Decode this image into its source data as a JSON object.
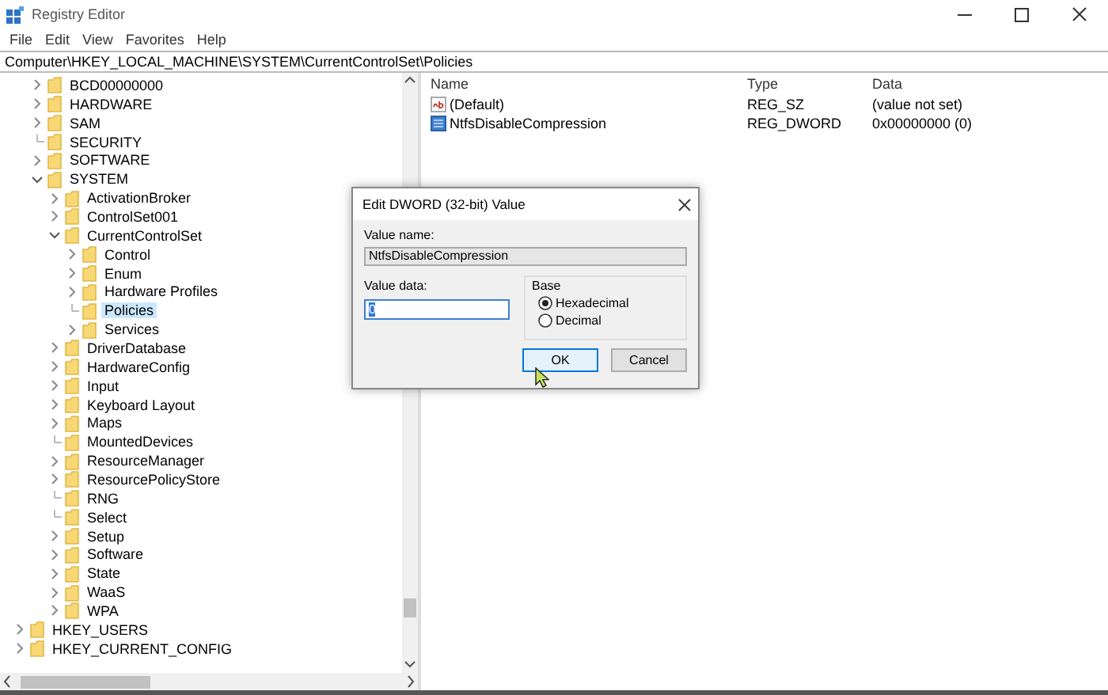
{
  "window": {
    "title": "Registry Editor"
  },
  "menu": [
    "File",
    "Edit",
    "View",
    "Favorites",
    "Help"
  ],
  "address": "Computer\\HKEY_LOCAL_MACHINE\\SYSTEM\\CurrentControlSet\\Policies",
  "tree": {
    "items": [
      {
        "label": "BCD00000000",
        "expandable": true,
        "expanded": false,
        "selected": false
      },
      {
        "label": "HARDWARE",
        "expandable": true,
        "expanded": false,
        "selected": false
      },
      {
        "label": "SAM",
        "expandable": true,
        "expanded": false,
        "selected": false
      },
      {
        "label": "SECURITY",
        "expandable": false,
        "selected": false
      },
      {
        "label": "SOFTWARE",
        "expandable": true,
        "expanded": false,
        "selected": false
      },
      {
        "label": "SYSTEM",
        "expandable": true,
        "expanded": true,
        "selected": false,
        "children": [
          {
            "label": "ActivationBroker",
            "expandable": true,
            "expanded": false,
            "selected": false
          },
          {
            "label": "ControlSet001",
            "expandable": true,
            "expanded": false,
            "selected": false
          },
          {
            "label": "CurrentControlSet",
            "expandable": true,
            "expanded": true,
            "selected": false,
            "children": [
              {
                "label": "Control",
                "expandable": true,
                "expanded": false,
                "selected": false
              },
              {
                "label": "Enum",
                "expandable": true,
                "expanded": false,
                "selected": false
              },
              {
                "label": "Hardware Profiles",
                "expandable": true,
                "expanded": false,
                "selected": false
              },
              {
                "label": "Policies",
                "expandable": false,
                "selected": true
              },
              {
                "label": "Services",
                "expandable": true,
                "expanded": false,
                "selected": false
              }
            ]
          },
          {
            "label": "DriverDatabase",
            "expandable": true,
            "expanded": false,
            "selected": false
          },
          {
            "label": "HardwareConfig",
            "expandable": true,
            "expanded": false,
            "selected": false
          },
          {
            "label": "Input",
            "expandable": true,
            "expanded": false,
            "selected": false
          },
          {
            "label": "Keyboard Layout",
            "expandable": true,
            "expanded": false,
            "selected": false
          },
          {
            "label": "Maps",
            "expandable": true,
            "expanded": false,
            "selected": false
          },
          {
            "label": "MountedDevices",
            "expandable": false,
            "selected": false
          },
          {
            "label": "ResourceManager",
            "expandable": true,
            "expanded": false,
            "selected": false
          },
          {
            "label": "ResourcePolicyStore",
            "expandable": true,
            "expanded": false,
            "selected": false
          },
          {
            "label": "RNG",
            "expandable": false,
            "selected": false
          },
          {
            "label": "Select",
            "expandable": false,
            "selected": false
          },
          {
            "label": "Setup",
            "expandable": true,
            "expanded": false,
            "selected": false
          },
          {
            "label": "Software",
            "expandable": true,
            "expanded": false,
            "selected": false
          },
          {
            "label": "State",
            "expandable": true,
            "expanded": false,
            "selected": false
          },
          {
            "label": "WaaS",
            "expandable": true,
            "expanded": false,
            "selected": false
          },
          {
            "label": "WPA",
            "expandable": true,
            "expanded": false,
            "selected": false
          }
        ]
      }
    ],
    "roots": [
      {
        "label": "HKEY_USERS",
        "expandable": true,
        "expanded": false,
        "selected": false
      },
      {
        "label": "HKEY_CURRENT_CONFIG",
        "expandable": true,
        "expanded": false,
        "selected": false
      }
    ]
  },
  "values": {
    "columns": [
      "Name",
      "Type",
      "Data"
    ],
    "rows": [
      {
        "kind": "string",
        "name": "(Default)",
        "type": "REG_SZ",
        "data": "(value not set)"
      },
      {
        "kind": "dword",
        "name": "NtfsDisableCompression",
        "type": "REG_DWORD",
        "data": "0x00000000 (0)"
      }
    ]
  },
  "dialog": {
    "title": "Edit DWORD (32-bit) Value",
    "value_name_label": "Value name:",
    "value_name": "NtfsDisableCompression",
    "value_data_label": "Value data:",
    "value_data": "0",
    "value_highlighted": true,
    "base_label": "Base",
    "base_options": [
      {
        "label": "Hexadecimal",
        "selected": true
      },
      {
        "label": "Decimal",
        "selected": false
      }
    ],
    "buttons": [
      {
        "label": "OK",
        "default": true
      },
      {
        "label": "Cancel",
        "default": false
      }
    ]
  }
}
